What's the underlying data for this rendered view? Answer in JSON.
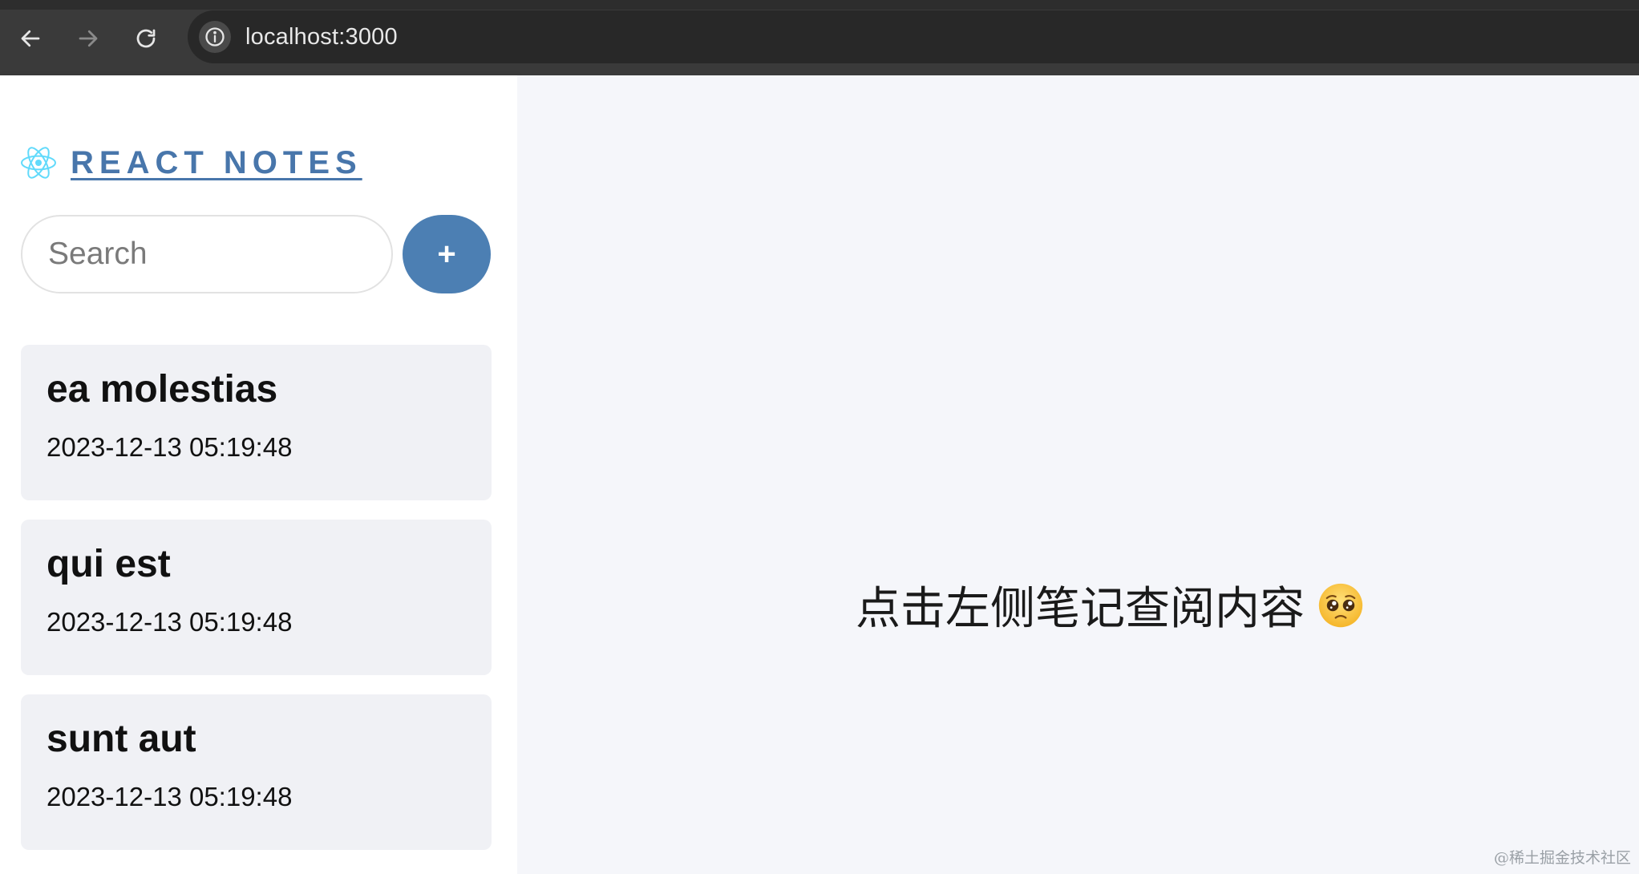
{
  "browser": {
    "url": "localhost:3000"
  },
  "sidebar": {
    "brand": "REACT NOTES",
    "search": {
      "placeholder": "Search",
      "value": ""
    },
    "new_button_label": "+",
    "notes": [
      {
        "title": "ea molestias",
        "date": "2023-12-13 05:19:48"
      },
      {
        "title": "qui est",
        "date": "2023-12-13 05:19:48"
      },
      {
        "title": "sunt aut",
        "date": "2023-12-13 05:19:48"
      }
    ]
  },
  "main": {
    "empty_message": "点击左侧笔记查阅内容",
    "emoji_icon": "pleading-face-icon"
  },
  "watermark": "@稀土掘金技术社区",
  "colors": {
    "brand": "#4876ab",
    "accent_button": "#4c7fb3",
    "note_card_bg": "#f0f1f5",
    "main_bg": "#f5f6fa"
  }
}
